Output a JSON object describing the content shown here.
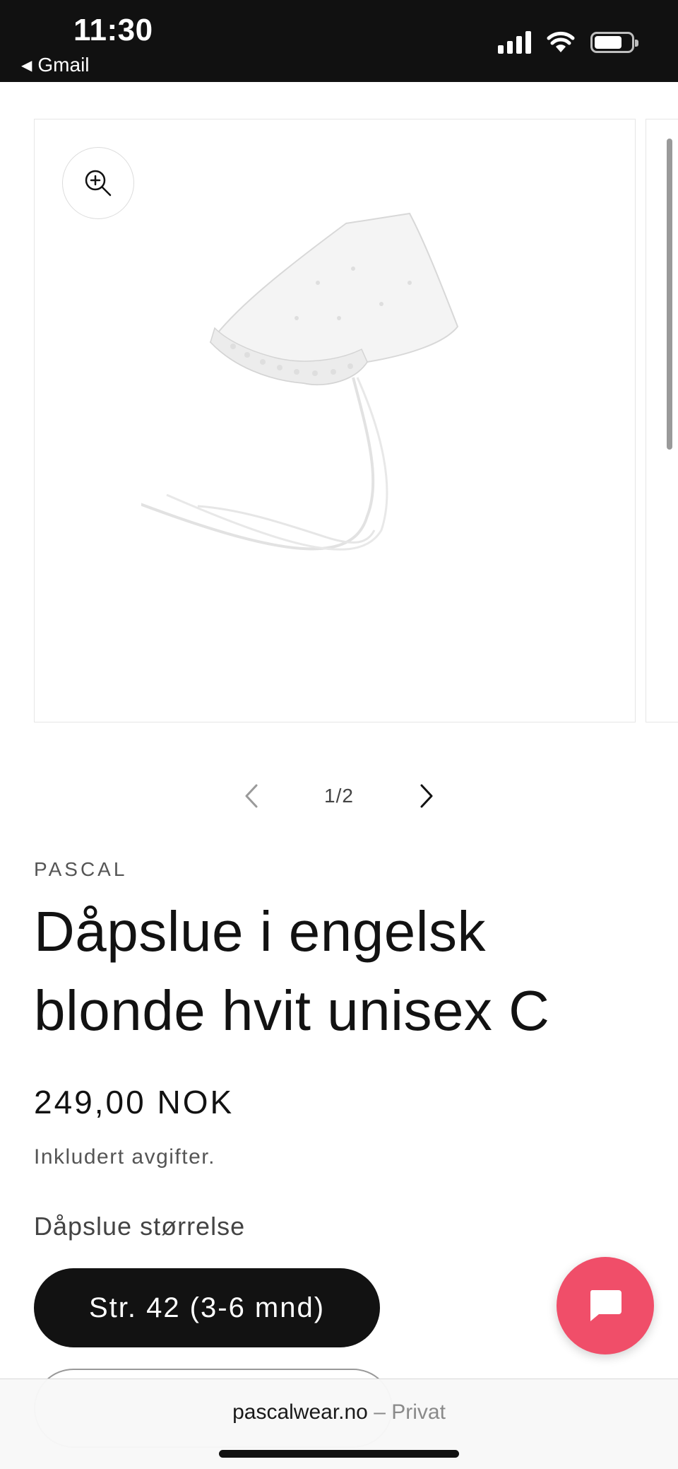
{
  "status_bar": {
    "time": "11:30",
    "back_label": "Gmail",
    "icons": [
      "signal-icon",
      "wifi-icon",
      "battery-icon"
    ]
  },
  "gallery": {
    "counter": "1/2",
    "icons": {
      "zoom": "zoom-in-icon",
      "prev": "chevron-left-icon",
      "next": "chevron-right-icon"
    }
  },
  "product": {
    "vendor": "PASCAL",
    "title_line1": "Dåpslue i engelsk",
    "title_line2": "blonde hvit unisex C",
    "price": "249,00 NOK",
    "tax_note": "Inkludert avgifter.",
    "option_label": "Dåpslue størrelse",
    "selected_size": "Str. 42 (3-6 mnd)"
  },
  "chat": {
    "icon": "chat-bubble-icon",
    "color": "#f04e69"
  },
  "browser": {
    "domain": "pascalwear.no",
    "separator": " – ",
    "mode": "Privat"
  },
  "colors": {
    "text": "#121212",
    "button_dark": "#121212",
    "accent": "#f04e69"
  }
}
